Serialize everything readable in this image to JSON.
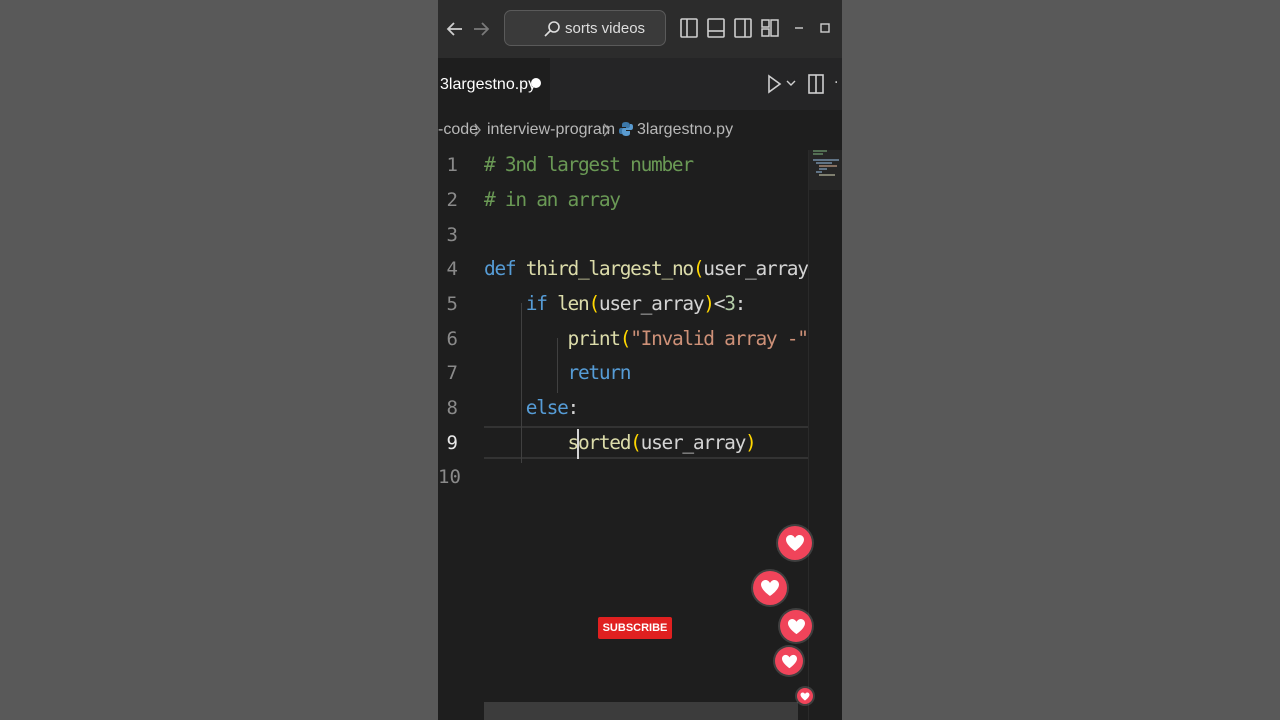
{
  "window": {
    "search_text": "sorts videos"
  },
  "tabs": [
    {
      "label": "3largestno.py",
      "modified": true,
      "active": true
    }
  ],
  "breadcrumb": {
    "items": [
      "-code",
      "interview-program",
      "3largestno.py"
    ]
  },
  "editor": {
    "current_line": 9,
    "language": "python",
    "lines": [
      {
        "number": "1",
        "text": "# 3nd largest number"
      },
      {
        "number": "2",
        "text": "# in an array"
      },
      {
        "number": "3",
        "text": ""
      },
      {
        "number": "4",
        "text": "def third_largest_no(user_array):"
      },
      {
        "number": "5",
        "text": "    if len(user_array)<3:"
      },
      {
        "number": "6",
        "text": "        print(\"Invalid array -\")"
      },
      {
        "number": "7",
        "text": "        return"
      },
      {
        "number": "8",
        "text": "    else:"
      },
      {
        "number": "9",
        "text": "        sorted(user_array)"
      },
      {
        "number": "10",
        "text": ""
      }
    ]
  },
  "overlay": {
    "subscribe_label": "SUBSCRIBE",
    "heart_count": 5
  },
  "colors": {
    "editor_bg": "#1e1e1e",
    "comment": "#6a9955",
    "keyword": "#569cd6",
    "function": "#dcdcaa",
    "string": "#ce9178",
    "bracket": "#ffd700",
    "subscribe": "#e02020",
    "heart": "#f0445a"
  },
  "icons": [
    "back-arrow-icon",
    "forward-arrow-icon",
    "search-icon",
    "toggle-primary-sidebar-icon",
    "toggle-panel-icon",
    "toggle-secondary-sidebar-icon",
    "customize-layout-icon",
    "minimize-icon",
    "maximize-icon",
    "run-icon",
    "chevron-down-icon",
    "split-editor-icon",
    "python-file-icon",
    "heart-icon"
  ]
}
